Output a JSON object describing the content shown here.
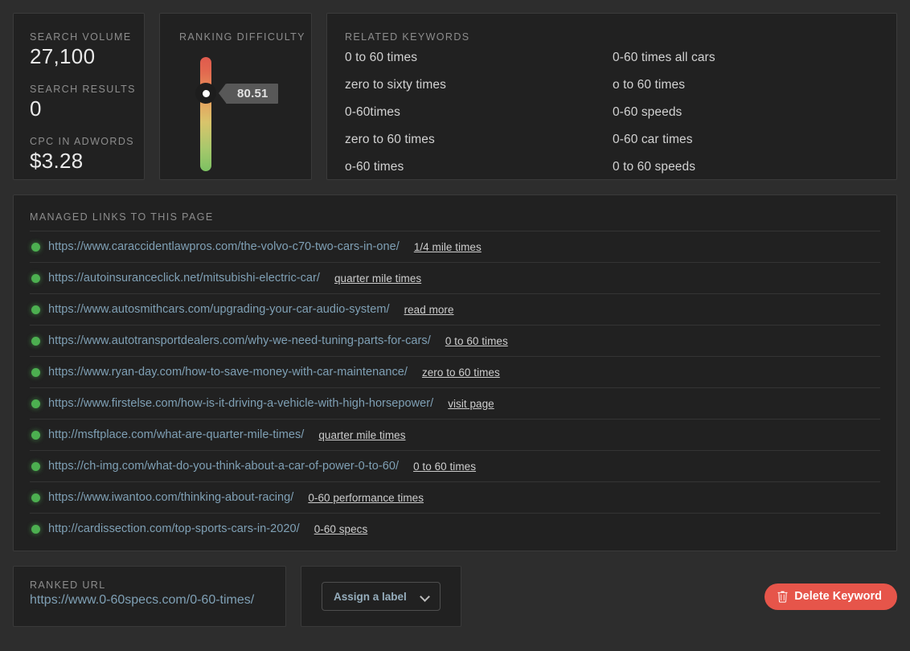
{
  "metrics": {
    "search_volume": {
      "label": "SEARCH VOLUME",
      "value": "27,100"
    },
    "search_results": {
      "label": "SEARCH RESULTS",
      "value": "0"
    },
    "cpc": {
      "label": "CPC IN ADWORDS",
      "value": "$3.28"
    }
  },
  "difficulty": {
    "label": "RANKING DIFFICULTY",
    "score": "80.51",
    "score_numeric": 80.51,
    "scale_top_color": "#e05a4e",
    "scale_bottom_color": "#7cc162"
  },
  "related_keywords": {
    "label": "RELATED KEYWORDS",
    "items": [
      "0 to 60 times",
      "0-60 times all cars",
      "zero to sixty times",
      "o to 60 times",
      "0-60times",
      "0-60 speeds",
      "zero to 60 times",
      "0-60 car times",
      "o-60 times",
      "0 to 60 speeds"
    ]
  },
  "managed_links": {
    "label": "MANAGED LINKS TO THIS PAGE",
    "rows": [
      {
        "status": "active",
        "url": "https://www.caraccidentlawpros.com/the-volvo-c70-two-cars-in-one/",
        "anchor": "1/4 mile times"
      },
      {
        "status": "active",
        "url": "https://autoinsuranceclick.net/mitsubishi-electric-car/",
        "anchor": "quarter mile times"
      },
      {
        "status": "active",
        "url": "https://www.autosmithcars.com/upgrading-your-car-audio-system/",
        "anchor": "read more"
      },
      {
        "status": "active",
        "url": "https://www.autotransportdealers.com/why-we-need-tuning-parts-for-cars/",
        "anchor": "0 to 60 times"
      },
      {
        "status": "active",
        "url": "https://www.ryan-day.com/how-to-save-money-with-car-maintenance/",
        "anchor": "zero to 60 times"
      },
      {
        "status": "active",
        "url": "https://www.firstelse.com/how-is-it-driving-a-vehicle-with-high-horsepower/",
        "anchor": "visit page"
      },
      {
        "status": "active",
        "url": "http://msftplace.com/what-are-quarter-mile-times/",
        "anchor": "quarter mile times"
      },
      {
        "status": "active",
        "url": "https://ch-img.com/what-do-you-think-about-a-car-of-power-0-to-60/",
        "anchor": "0 to 60 times"
      },
      {
        "status": "active",
        "url": "https://www.iwantoo.com/thinking-about-racing/",
        "anchor": "0-60 performance times"
      },
      {
        "status": "active",
        "url": "http://cardissection.com/top-sports-cars-in-2020/",
        "anchor": "0-60 specs"
      }
    ]
  },
  "ranked_url": {
    "label": "RANKED URL",
    "value": "https://www.0-60specs.com/0-60-times/"
  },
  "assign_label": {
    "text": "Assign a label"
  },
  "delete_button": {
    "text": "Delete Keyword",
    "color": "#e6554a"
  }
}
